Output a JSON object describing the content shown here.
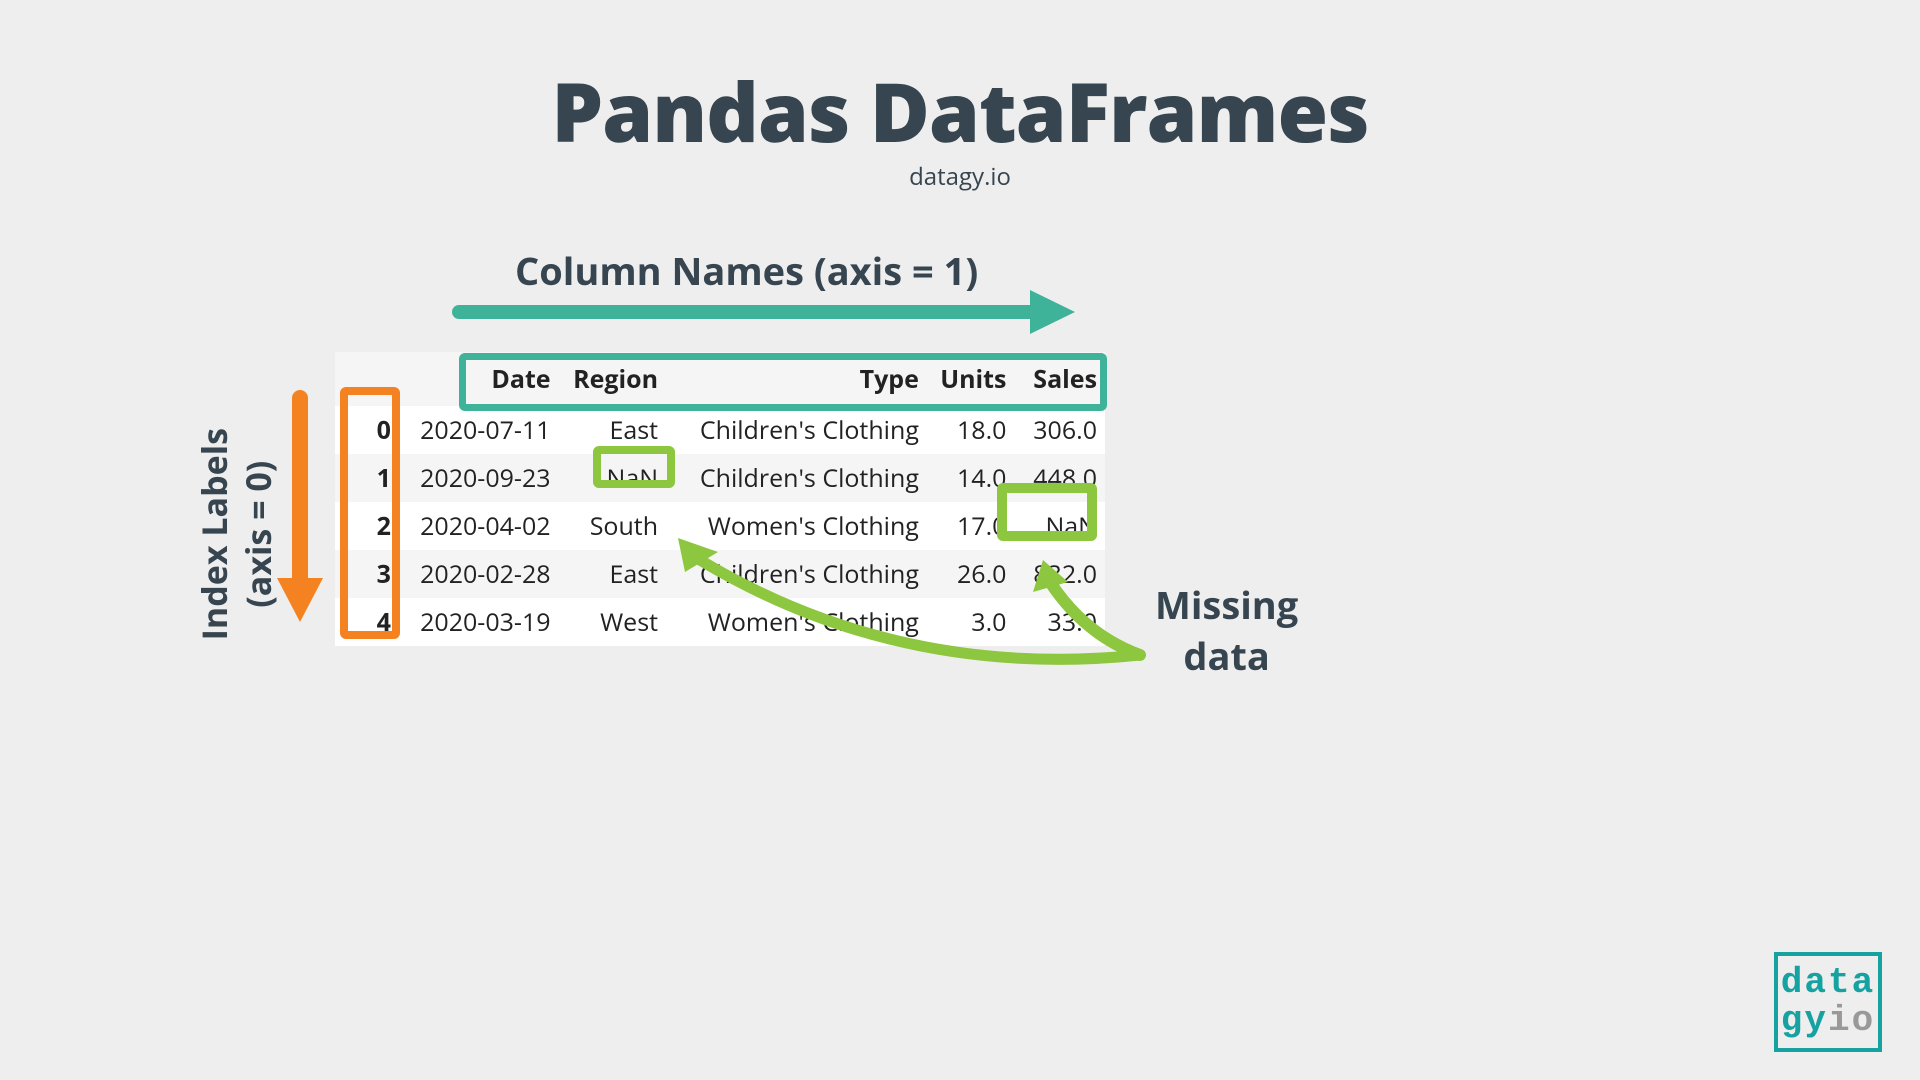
{
  "title": "Pandas DataFrames",
  "subtitle": "datagy.io",
  "labels": {
    "columns": "Column Names (axis = 1)",
    "index_line1": "Index Labels",
    "index_line2": "(axis = 0)",
    "missing_line1": "Missing",
    "missing_line2": "data"
  },
  "table": {
    "headers": [
      "",
      "Date",
      "Region",
      "Type",
      "Units",
      "Sales"
    ],
    "rows": [
      {
        "idx": "0",
        "date": "2020-07-11",
        "region": "East",
        "type": "Children's Clothing",
        "units": "18.0",
        "sales": "306.0"
      },
      {
        "idx": "1",
        "date": "2020-09-23",
        "region": "NaN",
        "type": "Children's Clothing",
        "units": "14.0",
        "sales": "448.0"
      },
      {
        "idx": "2",
        "date": "2020-04-02",
        "region": "South",
        "type": "Women's Clothing",
        "units": "17.0",
        "sales": "NaN"
      },
      {
        "idx": "3",
        "date": "2020-02-28",
        "region": "East",
        "type": "Children's Clothing",
        "units": "26.0",
        "sales": "832.0"
      },
      {
        "idx": "4",
        "date": "2020-03-19",
        "region": "West",
        "type": "Women's Clothing",
        "units": "3.0",
        "sales": "33.0"
      }
    ]
  },
  "logo": {
    "l1": "data",
    "l2a": "gy",
    "l2b": "io"
  },
  "colors": {
    "teal": "#3fb39a",
    "orange": "#f58220",
    "green": "#8dc63f",
    "dark": "#36454f"
  }
}
